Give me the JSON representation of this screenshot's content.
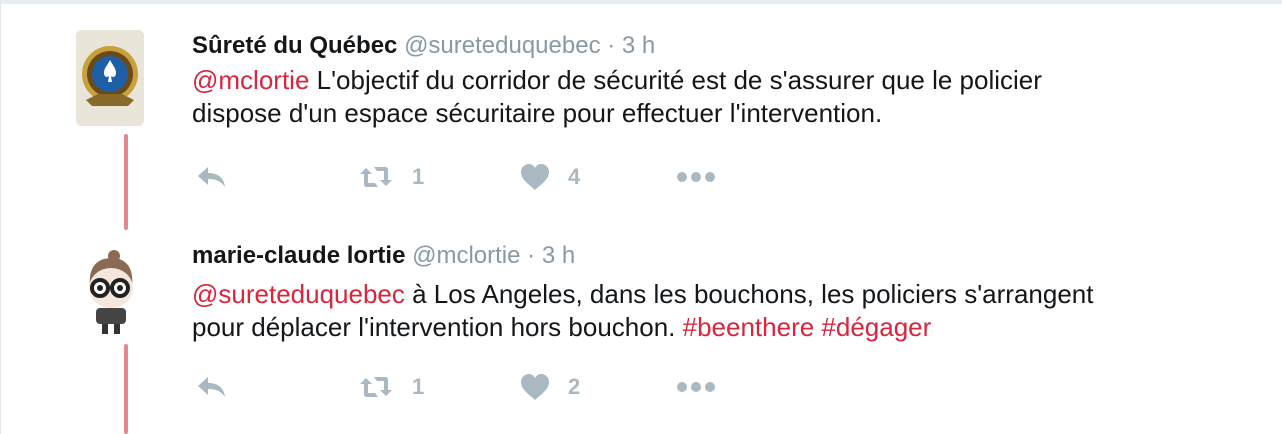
{
  "tweets": [
    {
      "author": {
        "name": "Sûreté du Québec",
        "handle": "@sureteduquebec",
        "avatar_icon": "surete-quebec-badge-icon"
      },
      "separator": "·",
      "time": "3 h",
      "text": {
        "mention": "@mclortie",
        "line1": " L'objectif du corridor de sécurité est de s'assurer que le policier",
        "line2": "dispose d'un espace sécuritaire pour effectuer l'intervention."
      },
      "actions": {
        "reply_icon": "reply-icon",
        "retweet_icon": "retweet-icon",
        "retweet_count": "1",
        "like_icon": "heart-icon",
        "like_count": "4",
        "more_icon": "more-icon"
      }
    },
    {
      "author": {
        "name": "marie-claude lortie",
        "handle": "@mclortie",
        "avatar_icon": "cartoon-girl-avatar-icon"
      },
      "separator": "·",
      "time": "3 h",
      "text": {
        "mention": "@sureteduquebec",
        "line1": " à Los Angeles, dans les bouchons, les policiers s'arrangent",
        "line2": "pour déplacer l'intervention hors bouchon. ",
        "hashtag1": "#beenthere",
        "space": " ",
        "hashtag2": "#dégager"
      },
      "actions": {
        "reply_icon": "reply-icon",
        "retweet_icon": "retweet-icon",
        "retweet_count": "1",
        "like_icon": "heart-icon",
        "like_count": "2",
        "more_icon": "more-icon"
      }
    }
  ],
  "colors": {
    "thread_line": "#e8858f",
    "link": "#d7263d",
    "meta": "#8899a6",
    "action": "#aab8c2"
  }
}
